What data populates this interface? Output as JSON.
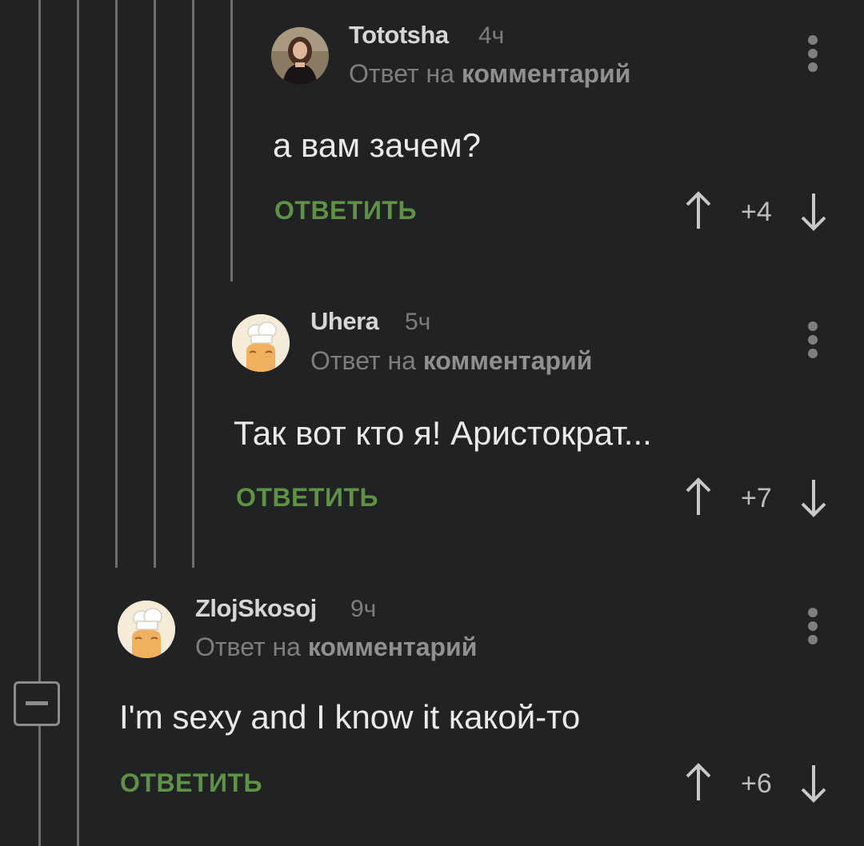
{
  "comments": [
    {
      "username": "Tototsha",
      "time": "4ч",
      "reply_prefix": "Ответ на",
      "reply_target": "комментарий",
      "body": "а вам зачем?",
      "reply_label": "ОТВЕТИТЬ",
      "score": "+4",
      "avatar_icon": "woman-photo-avatar"
    },
    {
      "username": "Uhera",
      "time": "5ч",
      "reply_prefix": "Ответ на",
      "reply_target": "комментарий",
      "body": "Так вот кто я! Аристократ...",
      "reply_label": "ОТВЕТИТЬ",
      "score": "+7",
      "avatar_icon": "chef-hat-avatar"
    },
    {
      "username": "ZlojSkosoj",
      "time": "9ч",
      "reply_prefix": "Ответ на",
      "reply_target": "комментарий",
      "body": "I'm sexy and I know it какой-то",
      "reply_label": "ОТВЕТИТЬ",
      "score": "+6",
      "avatar_icon": "chef-hat-avatar"
    }
  ],
  "colors": {
    "background": "#202224",
    "reply_button": "#5f9146",
    "thread_line": "#6c6e70"
  }
}
